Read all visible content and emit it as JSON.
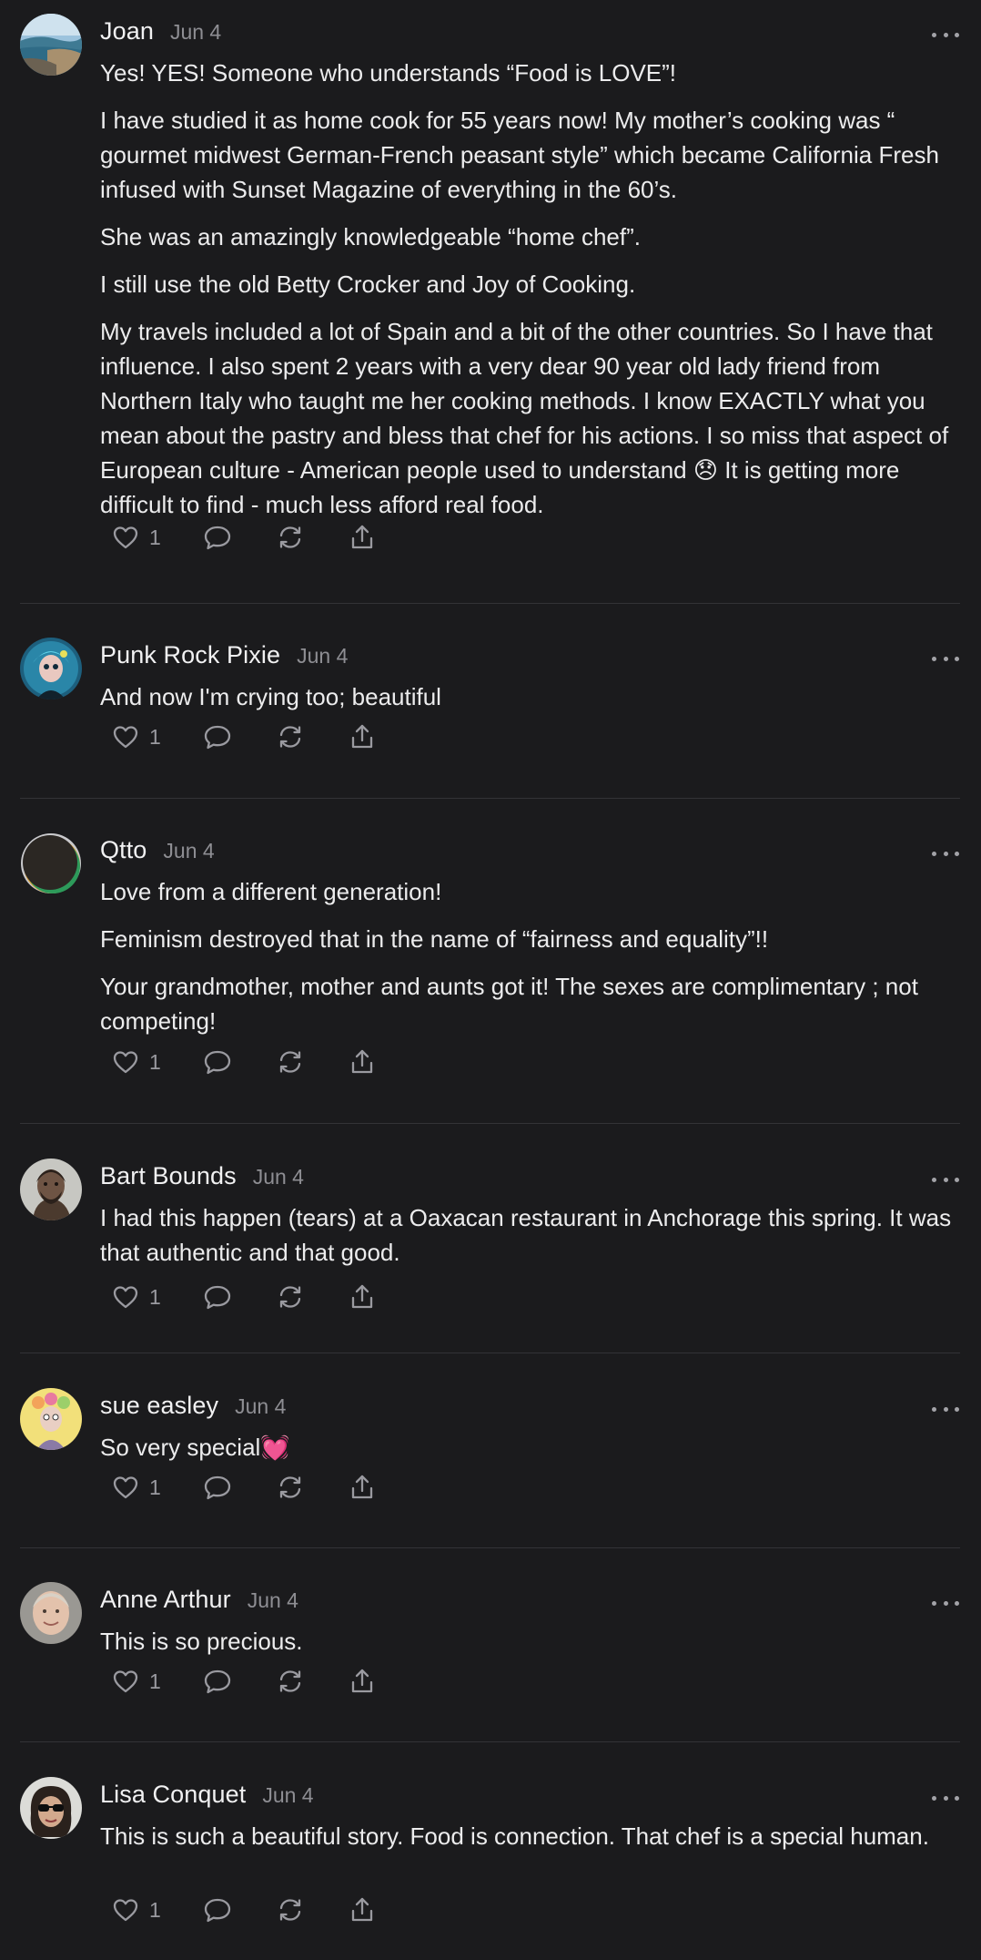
{
  "colors": {
    "background": "#1b1b1d",
    "text": "#ececed",
    "muted": "#8e8e93",
    "divider": "#333336",
    "icon": "#9a9aa0"
  },
  "icons": {
    "like": "heart-icon",
    "reply": "speech-bubble-icon",
    "restack": "refresh-icon",
    "share": "share-upload-icon",
    "more": "more-dots-icon"
  },
  "comments": [
    {
      "name": "Joan",
      "date": "Jun 4",
      "avatar": "beach-coast-photo",
      "paragraphs": [
        "Yes! YES! Someone who understands  “Food is LOVE”!",
        "I have studied it as home cook for 55 years now! My mother’s cooking was “ gourmet midwest German-French peasant style” which became California Fresh infused with Sunset Magazine of everything in the 60’s.",
        "She was an amazingly knowledgeable “home chef”.",
        "I still use the old Betty Crocker and Joy of Cooking.",
        "My travels included a lot of Spain and a bit of the other countries. So I have that influence. I also spent 2 years with a very dear 90 year old lady friend from Northern Italy who taught me her cooking methods. I know EXACTLY what you mean about the pastry and bless that chef for his actions. I so miss that aspect of European culture - American people used to understand 😞 It is getting more difficult to find - much less afford real food."
      ],
      "likes": "1"
    },
    {
      "name": "Punk Rock Pixie",
      "date": "Jun 4",
      "avatar": "blue-haired-pixie-illustration",
      "paragraphs": [
        "And now I'm crying too; beautiful"
      ],
      "likes": "1"
    },
    {
      "name": "Qtto",
      "date": "Jun 4",
      "avatar": "dark-circle-with-rainbow-rim",
      "paragraphs": [
        "Love from a different generation!",
        "Feminism destroyed that in the name of “fairness and equality”!!",
        "Your grandmother, mother and aunts got it! The sexes are complimentary ; not competing!"
      ],
      "likes": "1"
    },
    {
      "name": "Bart Bounds",
      "date": "Jun 4",
      "avatar": "caveman-portrait",
      "paragraphs": [
        "I had this happen (tears) at a Oaxacan restaurant in Anchorage this spring. It was that authentic and that good."
      ],
      "likes": "1"
    },
    {
      "name": "sue easley",
      "date": "Jun 4",
      "avatar": "flower-crown-portrait",
      "paragraphs": [
        "So very special💓"
      ],
      "likes": "1"
    },
    {
      "name": "Anne Arthur",
      "date": "Jun 4",
      "avatar": "smiling-woman-photo",
      "paragraphs": [
        "This is so precious."
      ],
      "likes": "1"
    },
    {
      "name": "Lisa Conquet",
      "date": "Jun 4",
      "avatar": "woman-with-sunglasses-photo",
      "paragraphs": [
        "This is such a beautiful story. Food is connection. That chef is a special human."
      ],
      "likes": "1"
    }
  ]
}
